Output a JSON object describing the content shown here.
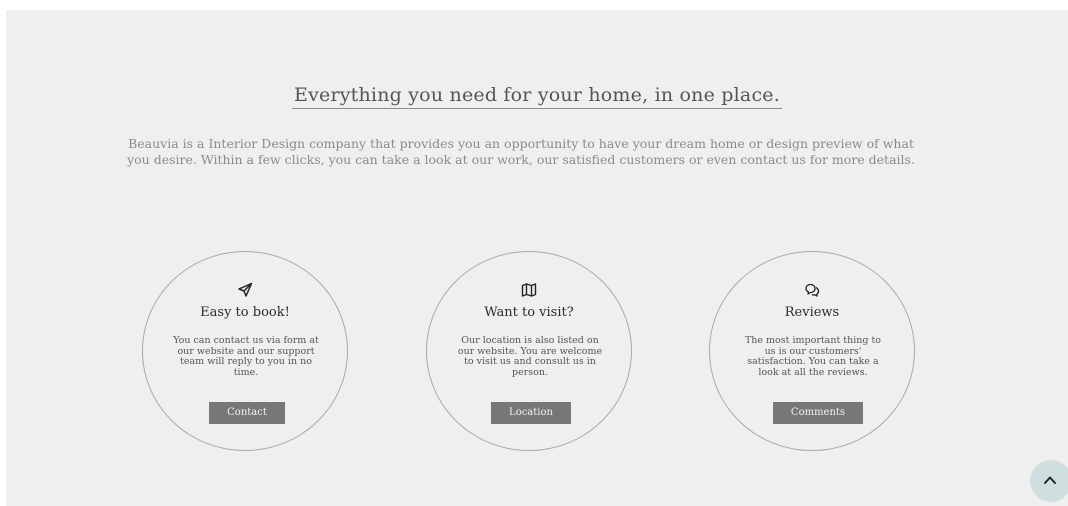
{
  "headline": "Everything you need for your home, in one place.",
  "intro": "Beauvia is a Interior Design company that provides you an opportunity to have your dream home or design preview of what you desire. Within a few clicks, you can take a look at our work, our satisfied customers or even contact us for more details.",
  "features": [
    {
      "icon": "paper-plane-icon",
      "title": "Easy to book!",
      "text": "You can contact us via form at our website and our support team will reply to you in no time.",
      "button": "Contact"
    },
    {
      "icon": "map-icon",
      "title": "Want to visit?",
      "text": "Our location is also listed on our website. You are welcome to visit us and consult us in person.",
      "button": "Location"
    },
    {
      "icon": "chat-bubbles-icon",
      "title": "Reviews",
      "text": "The most important thing to us is our customers' satisfaction. You can take a look at all the reviews.",
      "button": "Comments"
    }
  ],
  "scroll_top": {
    "icon": "chevron-up-icon"
  },
  "colors": {
    "section_background": "#efefef",
    "button_background": "#777777",
    "scroll_button_background": "#cfdfdf"
  }
}
